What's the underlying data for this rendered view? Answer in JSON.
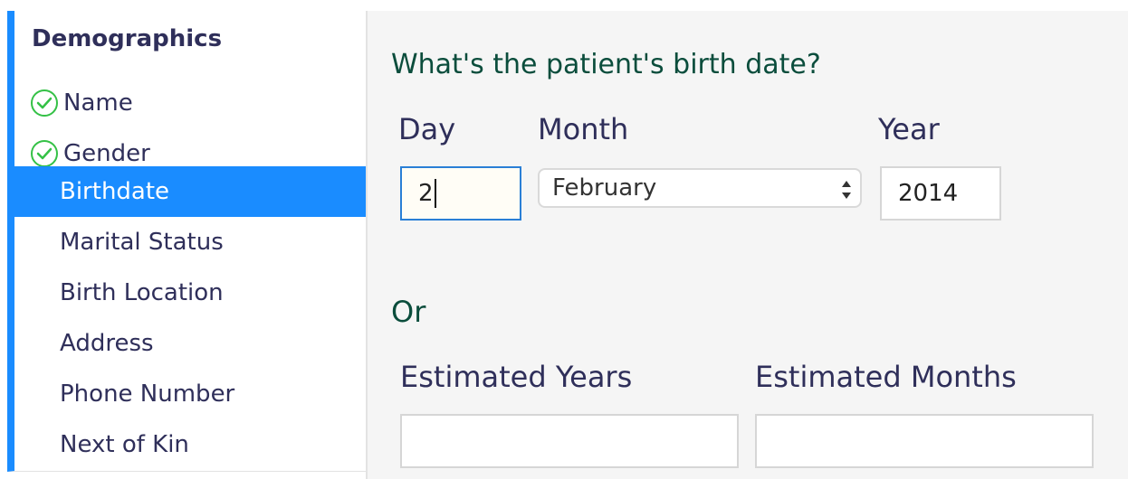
{
  "sidebar": {
    "title": "Demographics",
    "items": [
      {
        "label": "Name",
        "status": "done"
      },
      {
        "label": "Gender",
        "status": "done"
      },
      {
        "label": "Birthdate",
        "status": "active"
      },
      {
        "label": "Marital Status",
        "status": "pending"
      },
      {
        "label": "Birth Location",
        "status": "pending"
      },
      {
        "label": "Address",
        "status": "pending"
      },
      {
        "label": "Phone Number",
        "status": "pending"
      },
      {
        "label": "Next of Kin",
        "status": "pending"
      }
    ],
    "accent_color": "#1a8cff",
    "check_color": "#34c146"
  },
  "form": {
    "question": "What's the patient's birth date?",
    "day": {
      "label": "Day",
      "value": "2"
    },
    "month": {
      "label": "Month",
      "selected": "February"
    },
    "year": {
      "label": "Year",
      "value": "2014"
    },
    "or_label": "Or",
    "estimated_years": {
      "label": "Estimated Years",
      "value": ""
    },
    "estimated_months": {
      "label": "Estimated Months",
      "value": ""
    }
  },
  "icons": {
    "check": "check-circle-icon",
    "select_arrows": "updown-arrows-icon"
  }
}
